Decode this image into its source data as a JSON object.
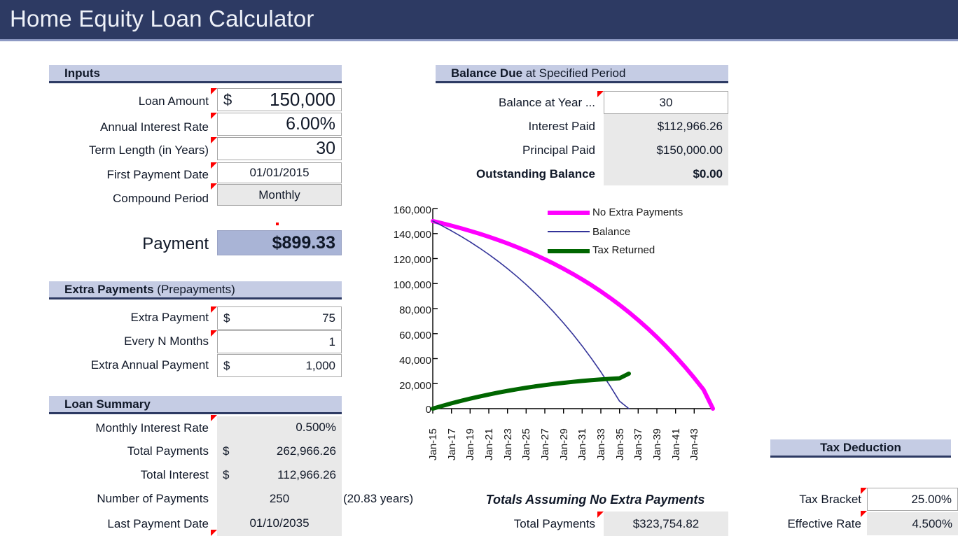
{
  "title": "Home Equity Loan Calculator",
  "sections": {
    "inputs": {
      "header_bold": "Inputs",
      "rows": [
        {
          "label": "Loan Amount",
          "prefix": "$",
          "value": "150,000"
        },
        {
          "label": "Annual Interest Rate",
          "prefix": "",
          "value": "6.00%"
        },
        {
          "label": "Term Length (in Years)",
          "prefix": "",
          "value": "30"
        },
        {
          "label": "First Payment Date",
          "prefix": "",
          "value": "01/01/2015"
        },
        {
          "label": "Compound Period",
          "prefix": "",
          "value": "Monthly"
        }
      ]
    },
    "payment": {
      "label": "Payment",
      "value": "$899.33"
    },
    "extra": {
      "header_bold": "Extra Payments",
      "header_light": " (Prepayments)",
      "rows": [
        {
          "label": "Extra Payment",
          "prefix": "$",
          "value": "75"
        },
        {
          "label": "Every N Months",
          "prefix": "",
          "value": "1"
        },
        {
          "label": "Extra Annual Payment",
          "prefix": "$",
          "value": "1,000"
        }
      ]
    },
    "loan_summary": {
      "header_bold": "Loan Summary",
      "rows": [
        {
          "label": "Monthly Interest Rate",
          "prefix": "",
          "value": "0.500%",
          "note": ""
        },
        {
          "label": "Total Payments",
          "prefix": "$",
          "value": "262,966.26",
          "note": ""
        },
        {
          "label": "Total Interest",
          "prefix": "$",
          "value": "112,966.26",
          "note": ""
        },
        {
          "label": "Number of Payments",
          "prefix": "",
          "value": "250",
          "note": "(20.83 years)"
        },
        {
          "label": "Last Payment Date",
          "prefix": "",
          "value": "01/10/2035",
          "note": ""
        }
      ]
    },
    "balance_due": {
      "header_bold": "Balance Due",
      "header_light": " at Specified Period",
      "rows": [
        {
          "label": "Balance at Year ...",
          "value": "30",
          "bold": false,
          "input": true
        },
        {
          "label": "Interest Paid",
          "value": "$112,966.26",
          "bold": false,
          "input": false
        },
        {
          "label": "Principal Paid",
          "value": "$150,000.00",
          "bold": false,
          "input": false
        },
        {
          "label": "Outstanding Balance",
          "value": "$0.00",
          "bold": true,
          "input": false
        }
      ]
    },
    "totals_no_extra": {
      "heading": "Totals Assuming No Extra Payments",
      "rows": [
        {
          "label": "Total Payments",
          "value": "$323,754.82"
        }
      ]
    },
    "tax_deduction": {
      "header_bold": "Tax Deduction",
      "rows": [
        {
          "label": "Tax Bracket",
          "value": "25.00%",
          "input": true
        },
        {
          "label": "Effective Rate",
          "value": "4.500%",
          "input": false
        }
      ]
    }
  },
  "colors": {
    "title_bar": "#2d3a63",
    "band": "#c5cce4",
    "payment_cell": "#a9b4d6",
    "shaded_cell": "#e9e9e9",
    "comment_marker": "#ff0000",
    "series_no_extra": "#ff00ff",
    "series_balance": "#333399",
    "series_tax_returned": "#006600"
  },
  "chart_data": {
    "type": "line",
    "title": "",
    "xlabel": "",
    "ylabel": "",
    "ylim": [
      0,
      160000
    ],
    "yticks": [
      "0",
      "20,000",
      "40,000",
      "60,000",
      "80,000",
      "100,000",
      "120,000",
      "140,000",
      "160,000"
    ],
    "ytick_values": [
      0,
      20000,
      40000,
      60000,
      80000,
      100000,
      120000,
      140000,
      160000
    ],
    "grid": false,
    "legend_position": "top-right",
    "xticks": [
      "Jan-15",
      "Jan-17",
      "Jan-19",
      "Jan-21",
      "Jan-23",
      "Jan-25",
      "Jan-27",
      "Jan-29",
      "Jan-31",
      "Jan-33",
      "Jan-35",
      "Jan-37",
      "Jan-39",
      "Jan-41",
      "Jan-43"
    ],
    "x": [
      2015,
      2016,
      2017,
      2018,
      2019,
      2020,
      2021,
      2022,
      2023,
      2024,
      2025,
      2026,
      2027,
      2028,
      2029,
      2030,
      2031,
      2032,
      2033,
      2034,
      2035,
      2036,
      2037,
      2038,
      2039,
      2040,
      2041,
      2042,
      2043,
      2044,
      2045
    ],
    "series": [
      {
        "name": "No Extra Payments",
        "color": "#ff00ff",
        "width": 6,
        "values": [
          150000,
          148200,
          146290,
          144260,
          142110,
          139830,
          137400,
          134830,
          132100,
          129200,
          126130,
          122870,
          119410,
          115740,
          111850,
          107720,
          103340,
          98690,
          93760,
          88520,
          82970,
          77080,
          70830,
          64200,
          57170,
          49720,
          41820,
          33450,
          24570,
          15160,
          0
        ]
      },
      {
        "name": "Balance",
        "color": "#333399",
        "width": 1.6,
        "values": [
          150000,
          146200,
          142160,
          137870,
          133300,
          128450,
          123290,
          117800,
          111970,
          105770,
          99190,
          92190,
          84760,
          76860,
          68470,
          59560,
          50090,
          40040,
          29360,
          18020,
          5990,
          0,
          null,
          null,
          null,
          null,
          null,
          null,
          null,
          null,
          null
        ]
      },
      {
        "name": "Tax Returned",
        "color": "#006600",
        "width": 6,
        "values": [
          0,
          2180,
          4240,
          6180,
          8000,
          9710,
          11310,
          12810,
          14200,
          15500,
          16710,
          17820,
          18850,
          19790,
          20650,
          21430,
          22140,
          22770,
          23340,
          23840,
          24280,
          28000,
          null,
          null,
          null,
          null,
          null,
          null,
          null,
          null,
          null
        ]
      }
    ]
  }
}
